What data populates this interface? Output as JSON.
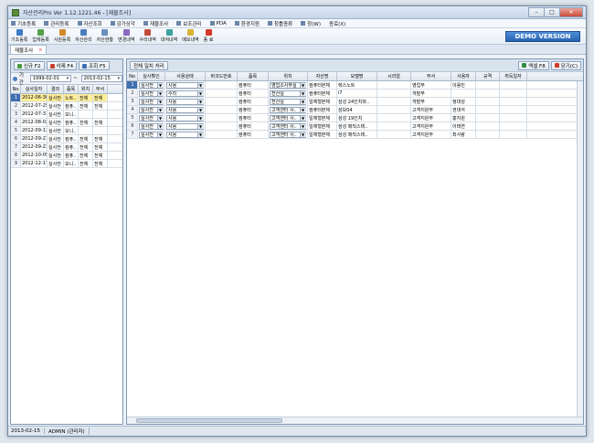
{
  "window": {
    "title": "자산관리Pro Ver 1.12.1221.46 - [재물조사]"
  },
  "menu": [
    "기초등록",
    "관리등록",
    "자산조회",
    "감가상각",
    "재물조사",
    "보조관리",
    "PDA",
    "환경지원",
    "창틀종류",
    "창(W)",
    "종료(X)"
  ],
  "toolbar": [
    {
      "label": "기초등록",
      "color": "#3d7ac9",
      "icon": "folder-icon"
    },
    {
      "label": "업체등록",
      "color": "#52a04a",
      "icon": "company-icon"
    },
    {
      "label": "사원등록",
      "color": "#d28a2c",
      "icon": "person-icon"
    },
    {
      "label": "자산관리",
      "color": "#4a7fbe",
      "icon": "asset-icon"
    },
    {
      "label": "자산현황",
      "color": "#6b8fbf",
      "icon": "status-icon"
    },
    {
      "label": "변경내역",
      "color": "#8a6bbd",
      "icon": "change-icon"
    },
    {
      "label": "수리내역",
      "color": "#c24a3a",
      "icon": "repair-icon"
    },
    {
      "label": "대여내역",
      "color": "#3aa3a0",
      "icon": "lend-icon"
    },
    {
      "label": "메모내역",
      "color": "#d9b236",
      "icon": "memo-icon"
    },
    {
      "label": "종 료",
      "color": "#d43a2a",
      "icon": "exit-icon"
    }
  ],
  "demo_badge": "DEMO VERSION",
  "tab": {
    "label": "재물조사",
    "close": "×"
  },
  "left_panel": {
    "buttons": [
      {
        "label": "신규 F2",
        "color": "#4c9a3c"
      },
      {
        "label": "삭제 F4",
        "color": "#c8412f"
      },
      {
        "label": "조회 F5",
        "color": "#3e6fb5"
      }
    ],
    "period_label": "기간",
    "date_from": "1999-02-01",
    "date_to": "2013-02-15",
    "date_separator": "~",
    "columns": [
      "No",
      "실사일자",
      "결과",
      "품목",
      "위치",
      "부서"
    ],
    "rows": [
      [
        "1",
        "2012-06-30",
        "실사전",
        "노트..",
        "전체",
        "전체"
      ],
      [
        "2",
        "2012-07-25",
        "실사전",
        "컴퓨..",
        "전체",
        "전체"
      ],
      [
        "3",
        "2012-07-31",
        "실사전",
        "모니..",
        "",
        ""
      ],
      [
        "4",
        "2012-08-02",
        "실사전",
        "컴퓨..",
        "전체",
        "전체"
      ],
      [
        "5",
        "2012-09-13",
        "실사전",
        "모니..",
        "",
        ""
      ],
      [
        "6",
        "2012-09-21",
        "실사전",
        "컴퓨..",
        "전체",
        "전체"
      ],
      [
        "7",
        "2012-09-23",
        "실사전",
        "컴퓨..",
        "전체",
        "전체"
      ],
      [
        "8",
        "2012-10-05",
        "실사전",
        "컴퓨..",
        "전체",
        "전체"
      ],
      [
        "9",
        "2012-12-17",
        "실사전",
        "모니..",
        "전체",
        "전체"
      ]
    ]
  },
  "right_panel": {
    "batch_button": "전체 일치 처리",
    "excel_button": "엑셀 F8",
    "close_button": "닫기(C)",
    "columns": [
      "No",
      "실사확인",
      "사용상태",
      "바코드번호",
      "품목",
      "위치",
      "자산명",
      "모델명",
      "시리얼",
      "부서",
      "사용자",
      "규격",
      "취득일자"
    ],
    "rows": [
      [
        "1",
        "실사전",
        "사용",
        "",
        "컴퓨터",
        "영업소사무실",
        "컴퓨터본체",
        "렉스노트",
        "",
        "영업부",
        "이용민",
        "",
        ""
      ],
      [
        "2",
        "실사전",
        "수리",
        "",
        "컴퓨터",
        "전산실",
        "컴퓨터본체",
        "i7",
        "",
        "개발부",
        "",
        "",
        ""
      ],
      [
        "3",
        "실사전",
        "사용",
        "",
        "컴퓨터",
        "전산실",
        "일체형본체",
        "삼성 24인치와..",
        "",
        "개발부",
        "정대성",
        "",
        ""
      ],
      [
        "4",
        "실사전",
        "사용",
        "",
        "컴퓨터",
        "고객센터 사..",
        "컴퓨터본체",
        "삼보04",
        "",
        "고객지원부",
        "권대석",
        "",
        ""
      ],
      [
        "5",
        "실사전",
        "사용",
        "",
        "컴퓨터",
        "고객센터 사..",
        "일체형본체",
        "삼성 19인치",
        "",
        "고객지원부",
        "홍지원",
        "",
        ""
      ],
      [
        "6",
        "실사전",
        "사용",
        "",
        "컴퓨터",
        "고객센터 사..",
        "일체형본체",
        "삼성 매직스테..",
        "",
        "고객지원부",
        "이태연",
        "",
        ""
      ],
      [
        "7",
        "실사전",
        "사용",
        "",
        "컴퓨터",
        "고객센터 사..",
        "일체형본체",
        "삼성 매직스테..",
        "",
        "고객지원부",
        "최사랑",
        "",
        ""
      ]
    ]
  },
  "status": {
    "date": "2013-02-15",
    "user": "ADMIN (관리자)"
  }
}
